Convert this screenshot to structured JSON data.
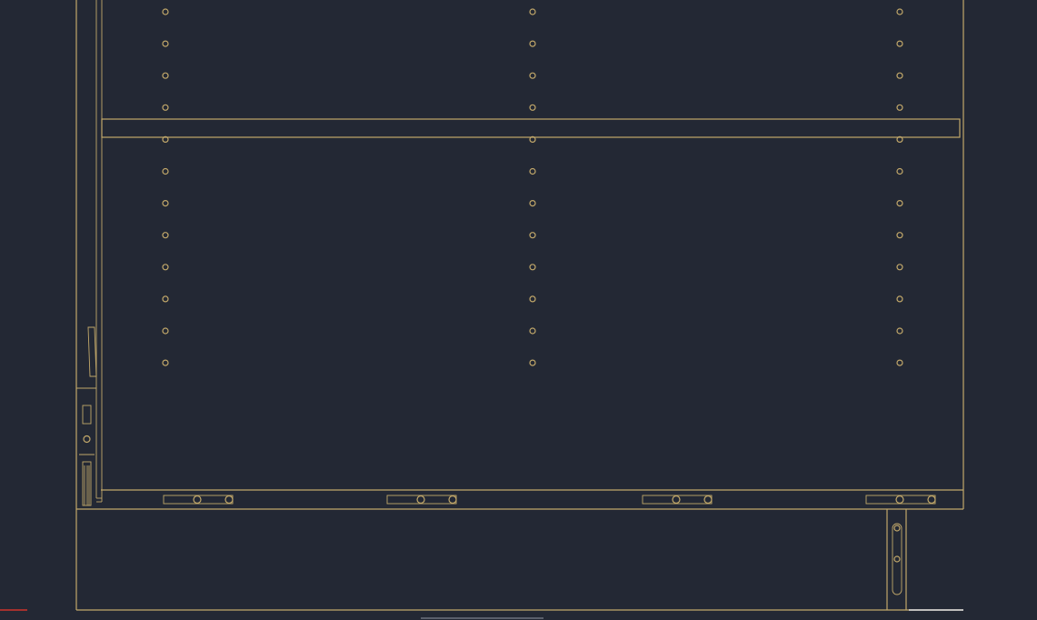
{
  "app": {
    "title": ""
  },
  "colors": {
    "canvas_background": "#232834",
    "geometry": "#c2a86a",
    "selection_red": "#d0342c",
    "highlight_white": "#e6e6e6"
  },
  "drawing": {
    "type": "cad-elevation",
    "hole_columns": 3,
    "hole_rows": 12,
    "bracket_slots": 4,
    "visible_text": []
  }
}
